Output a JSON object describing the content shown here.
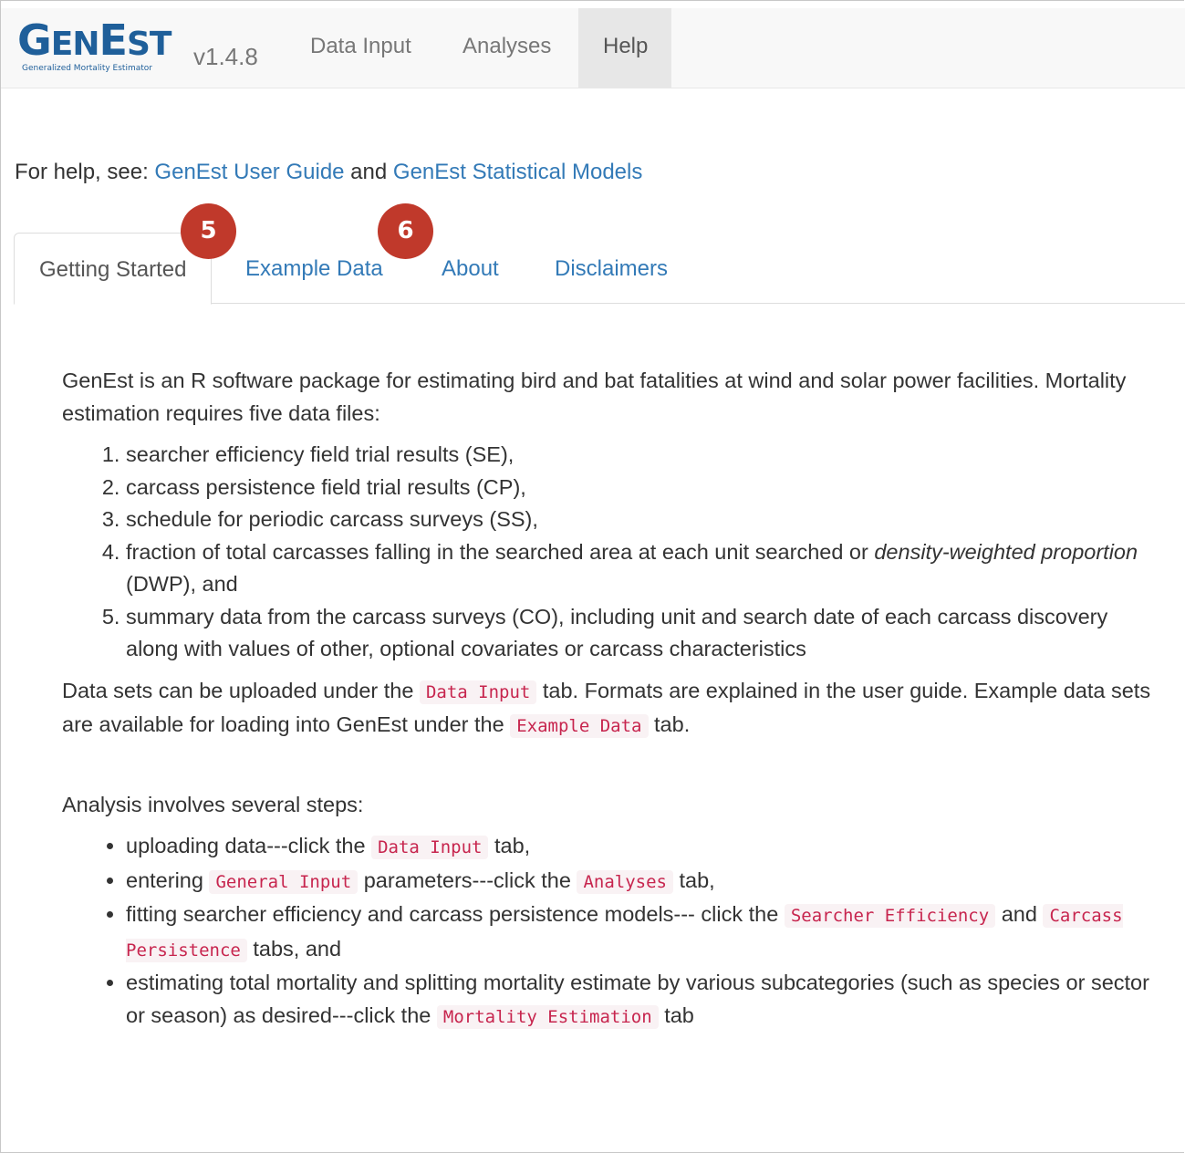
{
  "navbar": {
    "logo_main": "GenEst",
    "logo_sub": "Generalized Mortality Estimator",
    "version": "v1.4.8",
    "items": [
      {
        "label": "Data Input",
        "active": false
      },
      {
        "label": "Analyses",
        "active": false
      },
      {
        "label": "Help",
        "active": true
      }
    ]
  },
  "help": {
    "prefix": "For help, see: ",
    "link1": "GenEst User Guide",
    "and": " and ",
    "link2": "GenEst Statistical Models"
  },
  "tabs": [
    {
      "label": "Getting Started",
      "active": true
    },
    {
      "label": "Example Data",
      "active": false
    },
    {
      "label": "About",
      "active": false
    },
    {
      "label": "Disclaimers",
      "active": false
    }
  ],
  "badges": [
    "5",
    "6"
  ],
  "content": {
    "intro": "GenEst is an R software package for estimating bird and bat fatalities at wind and solar power facilities. Mortality estimation requires five data files:",
    "files": [
      "searcher efficiency field trial results (SE),",
      "carcass persistence field trial results (CP),",
      "schedule for periodic carcass surveys (SS),",
      {
        "pre": "fraction of total carcasses falling in the searched area at each unit searched or ",
        "em": "density-weighted proportion",
        "post": " (DWP), and"
      },
      "summary data from the carcass surveys (CO), including unit and search date of each carcass discovery along with values of other, optional covariates or carcass characteristics"
    ],
    "upload": {
      "t1": "Data sets can be uploaded under the ",
      "c1": "Data Input",
      "t2": " tab. Formats are explained in the user guide. Example data sets are available for loading into GenEst under the ",
      "c2": "Example Data",
      "t3": " tab."
    },
    "steps_intro": "Analysis involves several steps:",
    "steps": {
      "s1a": "uploading data---click the ",
      "s1c": "Data Input",
      "s1b": " tab,",
      "s2a": "entering ",
      "s2c1": "General Input",
      "s2b": " parameters---click the ",
      "s2c2": "Analyses",
      "s2d": " tab,",
      "s3a": "fitting searcher efficiency and carcass persistence models--- click the ",
      "s3c1": "Searcher Efficiency",
      "s3b": " and ",
      "s3c2": "Carcass Persistence",
      "s3d": " tabs, and",
      "s4a": "estimating total mortality and splitting mortality estimate by various subcategories (such as species or sector or season) as desired---click the ",
      "s4c": "Mortality Estimation",
      "s4b": " tab"
    }
  }
}
